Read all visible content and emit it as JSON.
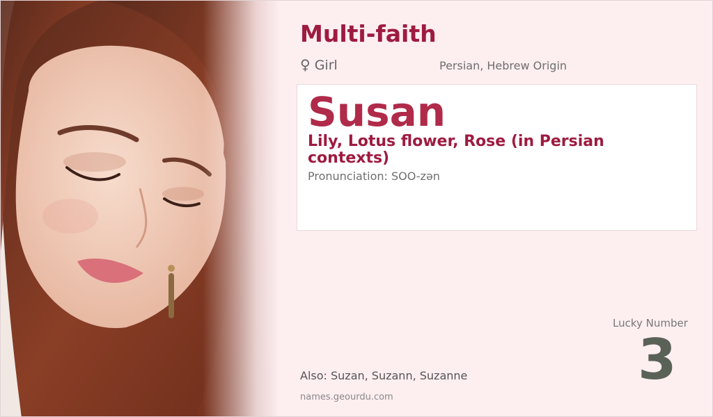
{
  "category": "Multi-faith",
  "gender": {
    "symbol": "♀",
    "label": "Girl"
  },
  "origin": "Persian, Hebrew Origin",
  "name": "Susan",
  "meaning": "Lily, Lotus flower, Rose (in Persian contexts)",
  "pronunciation": "Pronunciation: SOO-zən",
  "lucky": {
    "label": "Lucky Number",
    "number": "3"
  },
  "also": "Also: Suzan, Suzann, Suzanne",
  "site": "names.geourdu.com",
  "colors": {
    "accent": "#9e1b40",
    "background": "#fdeef0",
    "lucky": "#5a6258"
  },
  "photo": {
    "alt_icon": "portrait-photo"
  }
}
